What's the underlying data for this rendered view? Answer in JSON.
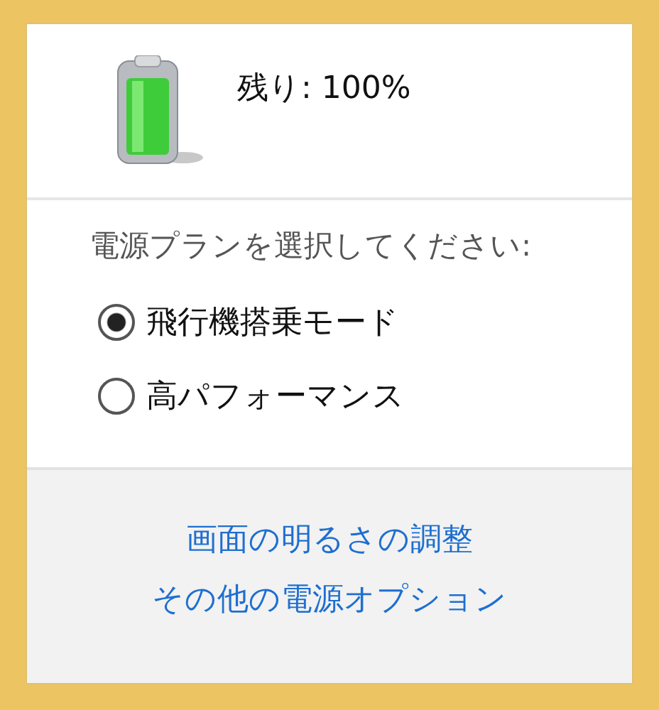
{
  "battery": {
    "remaining": "残り: 100%"
  },
  "power_plans": {
    "prompt": "電源プランを選択してください:",
    "options": [
      {
        "label": "飛行機搭乗モード",
        "selected": true
      },
      {
        "label": "高パフォーマンス",
        "selected": false
      }
    ]
  },
  "links": [
    "画面の明るさの調整",
    "その他の電源オプション"
  ]
}
